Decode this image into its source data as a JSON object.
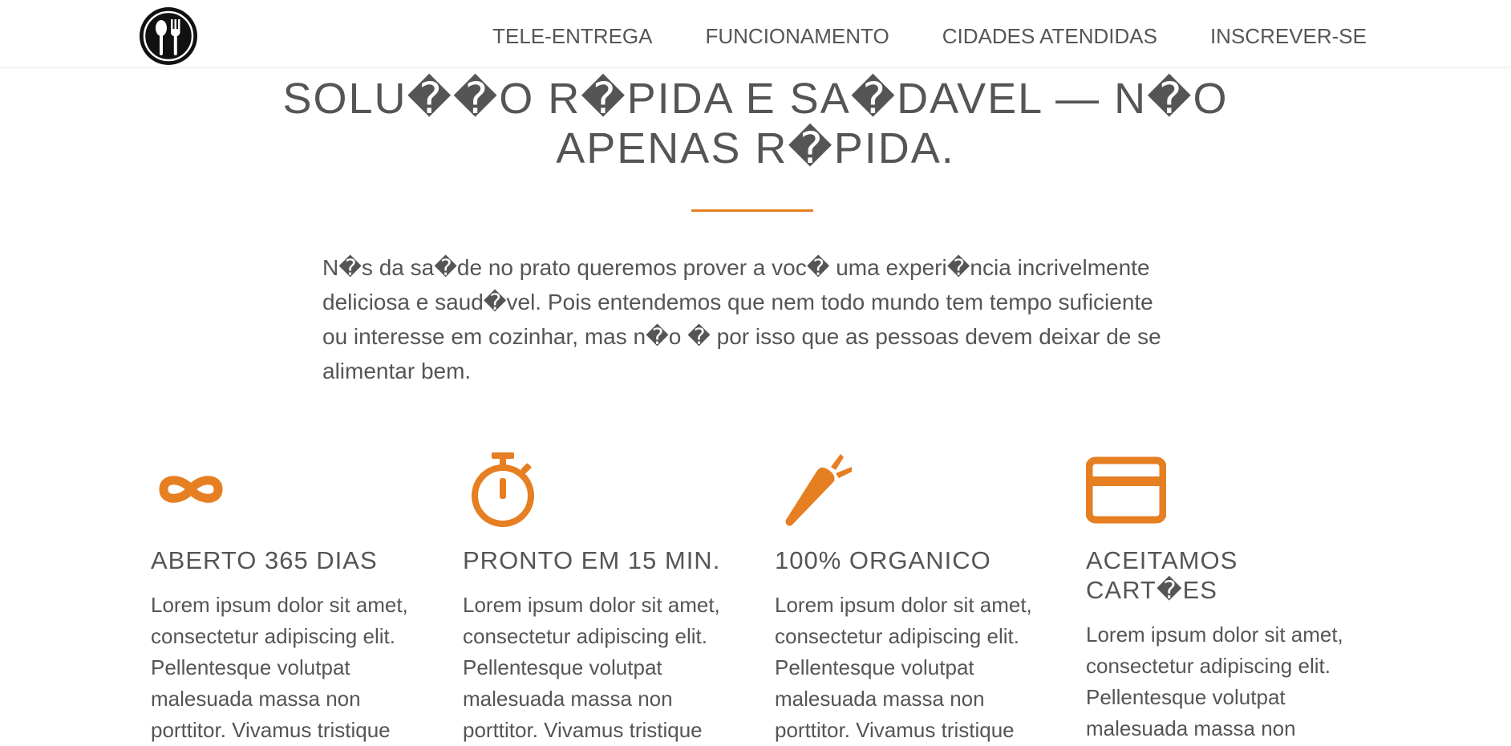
{
  "nav": {
    "logo": "fork-spoon-logo",
    "links": [
      "TELE-ENTREGA",
      "FUNCIONAMENTO",
      "CIDADES ATENDIDAS",
      "INSCREVER-SE"
    ]
  },
  "hero": {
    "title": "SOLU��O R�PIDA E SA�DAVEL — N�O APENAS R�PIDA.",
    "intro": "N�s da sa�de no prato queremos prover a voc� uma experi�ncia incrivelmente deliciosa e saud�vel. Pois entendemos que nem todo mundo tem tempo suficiente ou interesse em cozinhar, mas n�o � por isso que as pessoas devem deixar de se alimentar bem."
  },
  "features": [
    {
      "icon": "infinity-icon",
      "title": "ABERTO 365 DIAS",
      "text": "Lorem ipsum dolor sit amet, consectetur adipiscing elit. Pellentesque volutpat malesuada massa non porttitor. Vivamus tristique"
    },
    {
      "icon": "stopwatch-icon",
      "title": "PRONTO EM 15 MIN.",
      "text": "Lorem ipsum dolor sit amet, consectetur adipiscing elit. Pellentesque volutpat malesuada massa non porttitor. Vivamus tristique"
    },
    {
      "icon": "carrot-icon",
      "title": "100% ORGANICO",
      "text": "Lorem ipsum dolor sit amet, consectetur adipiscing elit. Pellentesque volutpat malesuada massa non porttitor. Vivamus tristique"
    },
    {
      "icon": "credit-card-icon",
      "title": "ACEITAMOS CART�ES",
      "text": "Lorem ipsum dolor sit amet, consectetur adipiscing elit. Pellentesque volutpat malesuada massa non"
    }
  ],
  "colors": {
    "accent": "#e67e22",
    "text": "#555555",
    "background": "#ffffff"
  }
}
